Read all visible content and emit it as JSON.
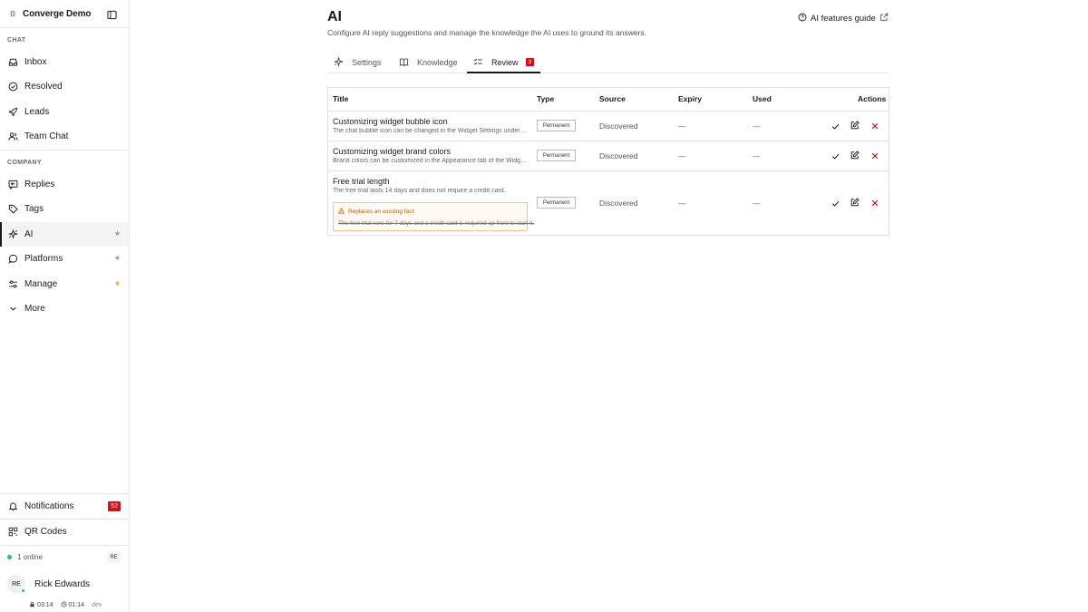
{
  "workspace": {
    "name": "Converge Demo"
  },
  "sidebar": {
    "sections": [
      {
        "label": "CHAT",
        "items": [
          {
            "label": "Inbox",
            "icon": "inbox-icon"
          },
          {
            "label": "Resolved",
            "icon": "check-circle-icon"
          },
          {
            "label": "Leads",
            "icon": "rocket-icon"
          },
          {
            "label": "Team Chat",
            "icon": "users-icon"
          }
        ]
      },
      {
        "label": "COMPANY",
        "items": [
          {
            "label": "Replies",
            "icon": "reply-icon"
          },
          {
            "label": "Tags",
            "icon": "tag-icon"
          },
          {
            "label": "AI",
            "icon": "sparkles-icon",
            "active": true,
            "star": "★"
          },
          {
            "label": "Platforms",
            "icon": "chat-bubble-icon",
            "star": "★"
          },
          {
            "label": "Manage",
            "icon": "sliders-icon",
            "star": "★"
          },
          {
            "label": "More",
            "icon": "chevron-down-icon"
          }
        ]
      }
    ],
    "bottom": {
      "notifications": {
        "label": "Notifications",
        "count": "52"
      },
      "qr": {
        "label": "QR Codes"
      },
      "online": {
        "label": "1 online",
        "initials": "RE"
      },
      "user": {
        "initials": "RE",
        "name": "Rick Edwards"
      },
      "meta": {
        "time1": "03:14",
        "time2": "01:14",
        "env": "dev"
      }
    }
  },
  "main": {
    "title": "AI",
    "description": "Configure AI reply suggestions and manage the knowledge the AI uses to ground its answers.",
    "guide_link": "AI features guide",
    "tabs": [
      {
        "label": "Settings",
        "icon": "sparkles-icon"
      },
      {
        "label": "Knowledge",
        "icon": "book-icon"
      },
      {
        "label": "Review",
        "icon": "list-check-icon",
        "count": "3",
        "active": true
      }
    ],
    "table": {
      "headers": {
        "title": "Title",
        "type": "Type",
        "source": "Source",
        "expiry": "Expiry",
        "used": "Used",
        "actions": "Actions"
      },
      "rows": [
        {
          "title": "Customizing widget bubble icon",
          "description": "The chat bubble icon can be changed in the Widget Settings under the Appearance tab.",
          "type": "Permanent",
          "source": "Discovered",
          "expiry": "—",
          "used": "—"
        },
        {
          "title": "Customizing widget brand colors",
          "description": "Brand colors can be customized in the Appearance tab of the Widget Settings page.",
          "type": "Permanent",
          "source": "Discovered",
          "expiry": "—",
          "used": "—"
        },
        {
          "title": "Free trial length",
          "description": "The free trial lasts 14 days and does not require a credit card.",
          "type": "Permanent",
          "source": "Discovered",
          "expiry": "—",
          "used": "—",
          "replaces": {
            "label": "Replaces an existing fact:",
            "old_text": "The free trial runs for 7 days and a credit card is required up front to start it."
          }
        }
      ]
    }
  },
  "colors": {
    "accent_red": "#d0101b",
    "warning_orange": "#c05a00",
    "online_green": "#22c55e",
    "star_orange": "#f5a623"
  }
}
